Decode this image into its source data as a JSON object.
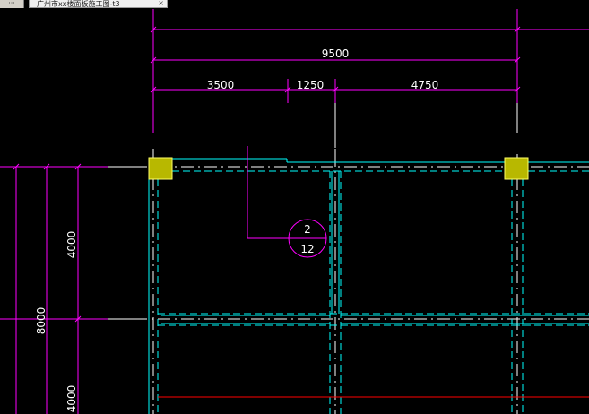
{
  "tabs": {
    "overflow_icon": "ellipsis-icon",
    "document_title": "广州市xx楼面板施工图-t3",
    "close_glyph": "×"
  },
  "drawing": {
    "dimensions_horizontal": {
      "overall": "9500",
      "segments": [
        "3500",
        "1250",
        "4750"
      ]
    },
    "dimensions_vertical": {
      "overall": "8000",
      "segments": [
        "4000",
        "4000"
      ]
    },
    "slab_mark": {
      "top": "2",
      "bottom": "12"
    },
    "colors": {
      "background": "#000000",
      "dimension_line": "#ff00ff",
      "wall_line": "#00ffff",
      "column_fill": "#b8b800",
      "grid_axis": "#ffffff",
      "rebar_red": "#ff0000",
      "text": "#ffffff"
    }
  }
}
